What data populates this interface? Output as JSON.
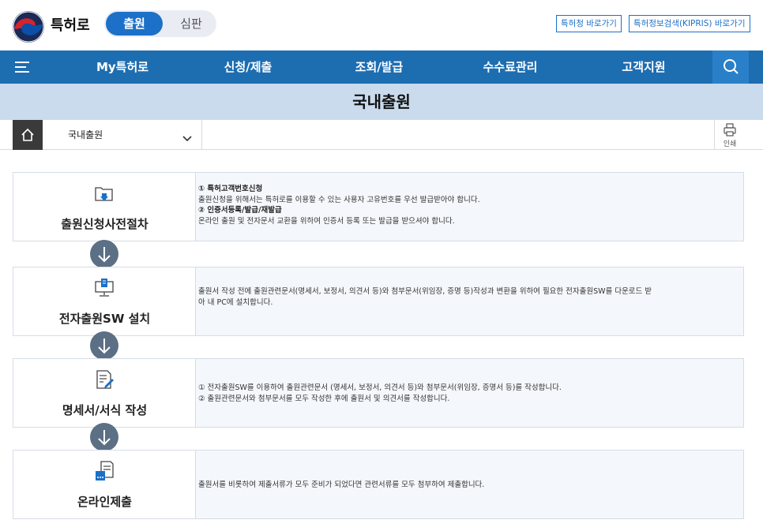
{
  "header": {
    "logo_text": "특허로",
    "segment": {
      "active": "출원",
      "inactive": "심판"
    },
    "links": [
      "특허청 바로가기",
      "특허정보검색(KIPRIS) 바로가기"
    ]
  },
  "nav": {
    "items": [
      "My특허로",
      "신청/제출",
      "조회/발급",
      "수수료관리",
      "고객지원"
    ],
    "menu_icon": "hamburger-icon",
    "search_icon": "search-icon"
  },
  "page_title": "국내출원",
  "breadcrumb": {
    "current": "국내출원",
    "print_label": "인쇄"
  },
  "steps": [
    {
      "title": "출원신청사전절차",
      "icon": "folder-download-icon",
      "lines": [
        {
          "text": "① 특허고객번호신청",
          "bold": true
        },
        {
          "text": "출원신청을 위해서는 특허로를 이용할 수 있는 사용자 고유번호를 우선 발급받아야 합니다.",
          "bold": false
        },
        {
          "text": "② 인증서등록/발급/재발급",
          "bold": true
        },
        {
          "text": "온라인 출원 및 전자문서 교환을 위하여 인증서 등록 또는 발급을 받으셔야 합니다.",
          "bold": false
        }
      ]
    },
    {
      "title": "전자출원SW 설치",
      "icon": "monitor-install-icon",
      "lines": [
        {
          "text": "출원서 작성 전에 출원관련문서(명세서, 보정서, 의견서 등)와 첨부문서(위임장, 증명 등)작성과 변환을 위하여 필요한 전자출원SW를 다운로드 받",
          "bold": false
        },
        {
          "text": "아 내 PC에 설치합니다.",
          "bold": false
        }
      ]
    },
    {
      "title": "명세서/서식 작성",
      "icon": "document-edit-icon",
      "lines": [
        {
          "text": "① 전자출원SW를 이용하여 출원관련문서 (명세서, 보정서, 의견서 등)와 첨부문서(위임장, 증명서 등)를 작성합니다.",
          "bold": false
        },
        {
          "text": "② 출원관련문서와 첨부문서를 모두 작성한 후에 출원서 및 의견서를 작성합니다.",
          "bold": false
        }
      ]
    },
    {
      "title": "온라인제출",
      "icon": "document-submit-icon",
      "lines": [
        {
          "text": "출원서를 비롯하여 제출서류가 모두 준비가 되었다면 관련서류를 모두 첨부하여 제출합니다.",
          "bold": false
        }
      ]
    }
  ],
  "colors": {
    "nav": "#1d6db1",
    "accent": "#1c70c8",
    "title_bar": "#c9dbec",
    "arrow": "#5b6f85"
  }
}
